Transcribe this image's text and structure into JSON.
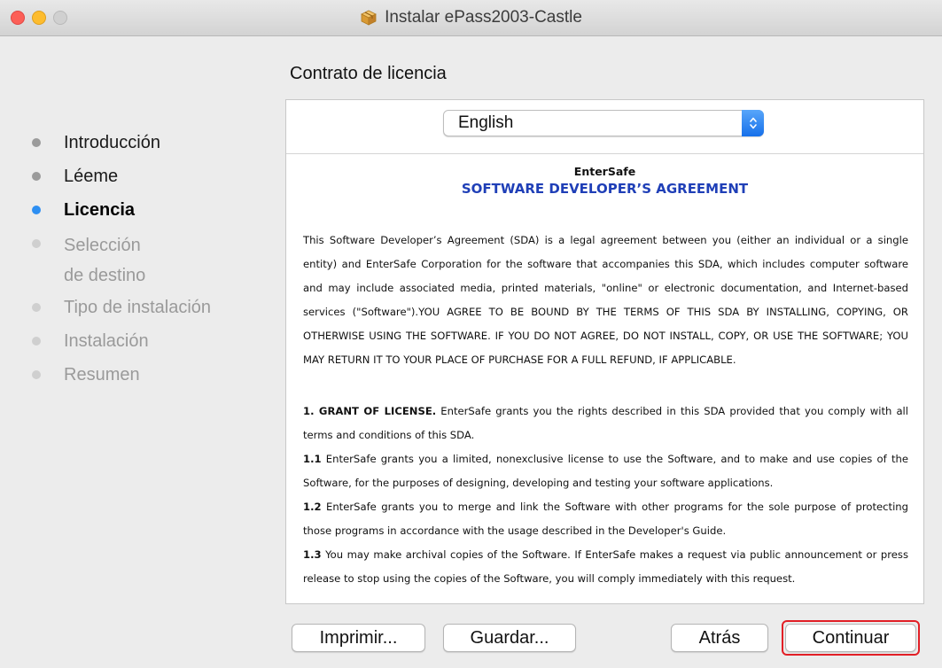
{
  "window": {
    "title": "Instalar ePass2003-Castle"
  },
  "sidebar": {
    "steps": [
      {
        "label": "Introducción",
        "state": "done"
      },
      {
        "label": "Léeme",
        "state": "done"
      },
      {
        "label": "Licencia",
        "state": "active"
      },
      {
        "label": "Selección\nde destino",
        "state": "future"
      },
      {
        "label": "Tipo de instalación",
        "state": "future"
      },
      {
        "label": "Instalación",
        "state": "future"
      },
      {
        "label": "Resumen",
        "state": "future"
      }
    ]
  },
  "main": {
    "section_title": "Contrato de licencia",
    "language": {
      "selected": "English"
    },
    "document": {
      "company": "EnterSafe",
      "heading": "SOFTWARE DEVELOPER’S AGREEMENT",
      "intro": "This Software Developer’s Agreement (SDA) is a legal agreement between you (either an individual or a single entity) and EnterSafe Corporation for the software that accompanies this SDA, which includes computer software and may include associated media, printed materials, \"online\" or electronic documentation, and Internet-based services (\"Software\").YOU AGREE TO BE BOUND BY THE TERMS OF THIS SDA BY INSTALLING, COPYING, OR OTHERWISE USING THE SOFTWARE. IF YOU DO NOT AGREE, DO NOT INSTALL, COPY, OR USE THE SOFTWARE; YOU MAY RETURN IT TO YOUR PLACE OF PURCHASE FOR A FULL REFUND, IF APPLICABLE.",
      "clauses": [
        {
          "num": "1. GRANT OF LICENSE.",
          "text": " EnterSafe grants you the rights described in this SDA provided that you comply with all terms and conditions of this SDA."
        },
        {
          "num": "1.1",
          "text": " EnterSafe grants you a limited, nonexclusive license to use the Software, and to make and use copies of the Software, for the purposes of designing, developing and testing your software applications."
        },
        {
          "num": "1.2",
          "text": " EnterSafe grants you to merge and link the Software with other programs for the sole purpose of protecting those programs in accordance with the usage described in the Developer's Guide."
        },
        {
          "num": "1.3",
          "text": " You may make archival copies of the Software. If EnterSafe makes a request via public announcement or press release to stop using the copies of the Software, you will comply immediately with this request."
        }
      ]
    }
  },
  "buttons": {
    "print": "Imprimir...",
    "save": "Guardar...",
    "back": "Atrás",
    "continue": "Continuar"
  },
  "colors": {
    "active_step": "#2e8ff2",
    "heading": "#1f3fb7",
    "highlight": "#e21f26"
  }
}
